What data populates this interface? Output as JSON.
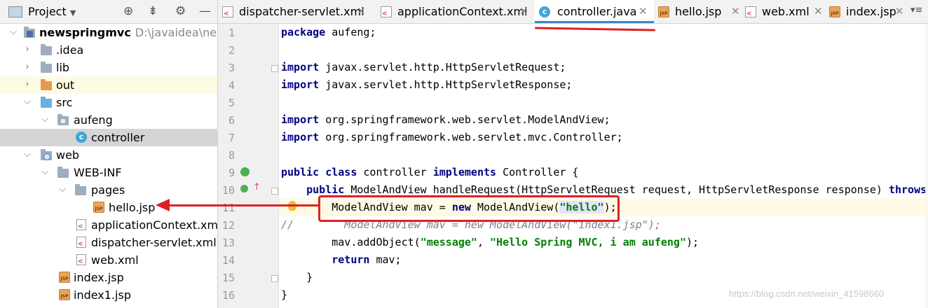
{
  "project_panel": {
    "title": "Project",
    "tree": [
      {
        "label": "newspringmvc",
        "hint": "D:\\javaidea\\newspr",
        "level": 0,
        "expanded": true,
        "icon": "module-folder-icon"
      },
      {
        "label": ".idea",
        "level": 1,
        "expanded": false,
        "icon": "folder-icon"
      },
      {
        "label": "lib",
        "level": 1,
        "expanded": false,
        "icon": "folder-icon"
      },
      {
        "label": "out",
        "level": 1,
        "expanded": false,
        "icon": "orange-folder-icon"
      },
      {
        "label": "src",
        "level": 1,
        "expanded": true,
        "icon": "source-folder-icon"
      },
      {
        "label": "aufeng",
        "level": 2,
        "expanded": true,
        "icon": "package-icon"
      },
      {
        "label": "controller",
        "level": 3,
        "icon": "java-class-icon",
        "selected": true
      },
      {
        "label": "web",
        "level": 1,
        "expanded": true,
        "icon": "web-folder-icon"
      },
      {
        "label": "WEB-INF",
        "level": 2,
        "expanded": true,
        "icon": "folder-icon"
      },
      {
        "label": "pages",
        "level": 3,
        "expanded": true,
        "icon": "folder-icon"
      },
      {
        "label": "hello.jsp",
        "level": 4,
        "icon": "jsp-file-icon"
      },
      {
        "label": "applicationContext.xml",
        "level": 3,
        "icon": "xml-file-icon"
      },
      {
        "label": "dispatcher-servlet.xml",
        "level": 3,
        "icon": "xml-file-icon"
      },
      {
        "label": "web.xml",
        "level": 3,
        "icon": "xml-file-icon"
      },
      {
        "label": "index.jsp",
        "level": 2,
        "icon": "jsp-file-icon"
      },
      {
        "label": "index1.jsp",
        "level": 2,
        "icon": "jsp-file-icon"
      }
    ]
  },
  "tabs": [
    {
      "label": "dispatcher-servlet.xml",
      "icon": "xml-file-icon"
    },
    {
      "label": "applicationContext.xml",
      "icon": "xml-file-icon"
    },
    {
      "label": "controller.java",
      "icon": "java-class-icon",
      "active": true
    },
    {
      "label": "hello.jsp",
      "icon": "jsp-file-icon"
    },
    {
      "label": "web.xml",
      "icon": "xml-file-icon"
    },
    {
      "label": "index.jsp",
      "icon": "jsp-file-icon"
    }
  ],
  "editor": {
    "line_numbers": [
      "1",
      "2",
      "3",
      "4",
      "5",
      "6",
      "7",
      "8",
      "9",
      "10",
      "11",
      "12",
      "13",
      "14",
      "15",
      "16"
    ],
    "code": {
      "l1_kw": "package",
      "l1_rest": " aufeng;",
      "l3_kw": "import",
      "l3_rest": " javax.servlet.http.HttpServletRequest;",
      "l4_kw": "import",
      "l4_rest": " javax.servlet.http.HttpServletResponse;",
      "l6_kw": "import",
      "l6_rest": " org.springframework.web.servlet.ModelAndView;",
      "l7_kw": "import",
      "l7_rest": " org.springframework.web.servlet.mvc.Controller;",
      "l9_kw1": "public class",
      "l9_mid": " controller ",
      "l9_kw2": "implements",
      "l9_rest": " Controller {",
      "l10_indent": "    ",
      "l10_kw": "public",
      "l10_rest": " ModelAndView handleRequest(HttpServletRequest request, HttpServletResponse response) ",
      "l10_kw2": "throws",
      "l11_pre": "        ModelAndView mav = ",
      "l11_kw": "new",
      "l11_mid": " ModelAndView(",
      "l11_str": "\"hello\"",
      "l11_end": ");",
      "l12": "//        ModelAndView mav = new ModelAndView(\"index1.jsp\");",
      "l13_pre": "        mav.addObject(",
      "l13_str1": "\"message\"",
      "l13_mid": ", ",
      "l13_str2": "\"Hello Spring MVC, i am aufeng\"",
      "l13_end": ");",
      "l14_indent": "        ",
      "l14_kw": "return",
      "l14_rest": " mav;",
      "l15": "    }",
      "l16": "}"
    }
  },
  "watermark": "https://blog.csdn.net/weixin_41598660",
  "colors": {
    "annotation": "#e02020",
    "selected_row": "#d5d5d5",
    "active_tab_indicator": "#4083c9"
  }
}
